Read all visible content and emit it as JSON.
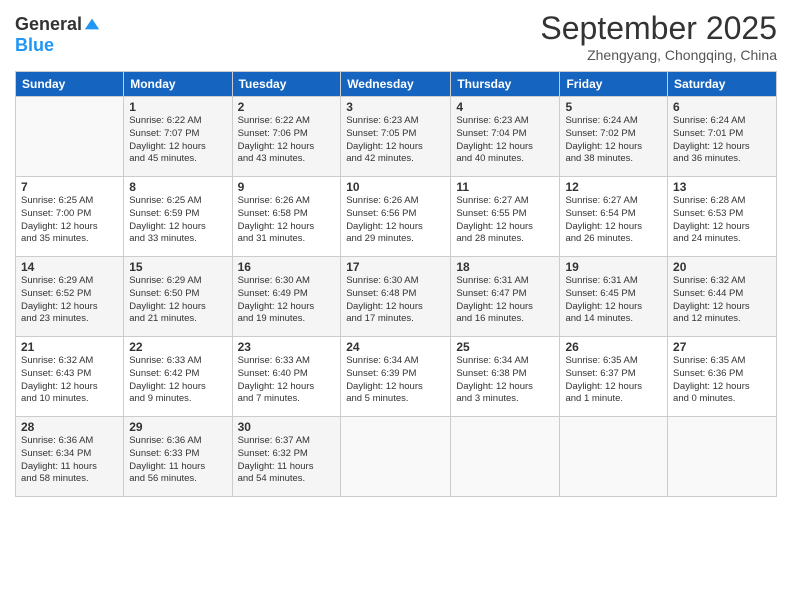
{
  "header": {
    "logo": {
      "general": "General",
      "blue": "Blue"
    },
    "title": "September 2025",
    "location": "Zhengyang, Chongqing, China"
  },
  "weekdays": [
    "Sunday",
    "Monday",
    "Tuesday",
    "Wednesday",
    "Thursday",
    "Friday",
    "Saturday"
  ],
  "weeks": [
    [
      {
        "day": "",
        "info": ""
      },
      {
        "day": "1",
        "info": "Sunrise: 6:22 AM\nSunset: 7:07 PM\nDaylight: 12 hours\nand 45 minutes."
      },
      {
        "day": "2",
        "info": "Sunrise: 6:22 AM\nSunset: 7:06 PM\nDaylight: 12 hours\nand 43 minutes."
      },
      {
        "day": "3",
        "info": "Sunrise: 6:23 AM\nSunset: 7:05 PM\nDaylight: 12 hours\nand 42 minutes."
      },
      {
        "day": "4",
        "info": "Sunrise: 6:23 AM\nSunset: 7:04 PM\nDaylight: 12 hours\nand 40 minutes."
      },
      {
        "day": "5",
        "info": "Sunrise: 6:24 AM\nSunset: 7:02 PM\nDaylight: 12 hours\nand 38 minutes."
      },
      {
        "day": "6",
        "info": "Sunrise: 6:24 AM\nSunset: 7:01 PM\nDaylight: 12 hours\nand 36 minutes."
      }
    ],
    [
      {
        "day": "7",
        "info": "Sunrise: 6:25 AM\nSunset: 7:00 PM\nDaylight: 12 hours\nand 35 minutes."
      },
      {
        "day": "8",
        "info": "Sunrise: 6:25 AM\nSunset: 6:59 PM\nDaylight: 12 hours\nand 33 minutes."
      },
      {
        "day": "9",
        "info": "Sunrise: 6:26 AM\nSunset: 6:58 PM\nDaylight: 12 hours\nand 31 minutes."
      },
      {
        "day": "10",
        "info": "Sunrise: 6:26 AM\nSunset: 6:56 PM\nDaylight: 12 hours\nand 29 minutes."
      },
      {
        "day": "11",
        "info": "Sunrise: 6:27 AM\nSunset: 6:55 PM\nDaylight: 12 hours\nand 28 minutes."
      },
      {
        "day": "12",
        "info": "Sunrise: 6:27 AM\nSunset: 6:54 PM\nDaylight: 12 hours\nand 26 minutes."
      },
      {
        "day": "13",
        "info": "Sunrise: 6:28 AM\nSunset: 6:53 PM\nDaylight: 12 hours\nand 24 minutes."
      }
    ],
    [
      {
        "day": "14",
        "info": "Sunrise: 6:29 AM\nSunset: 6:52 PM\nDaylight: 12 hours\nand 23 minutes."
      },
      {
        "day": "15",
        "info": "Sunrise: 6:29 AM\nSunset: 6:50 PM\nDaylight: 12 hours\nand 21 minutes."
      },
      {
        "day": "16",
        "info": "Sunrise: 6:30 AM\nSunset: 6:49 PM\nDaylight: 12 hours\nand 19 minutes."
      },
      {
        "day": "17",
        "info": "Sunrise: 6:30 AM\nSunset: 6:48 PM\nDaylight: 12 hours\nand 17 minutes."
      },
      {
        "day": "18",
        "info": "Sunrise: 6:31 AM\nSunset: 6:47 PM\nDaylight: 12 hours\nand 16 minutes."
      },
      {
        "day": "19",
        "info": "Sunrise: 6:31 AM\nSunset: 6:45 PM\nDaylight: 12 hours\nand 14 minutes."
      },
      {
        "day": "20",
        "info": "Sunrise: 6:32 AM\nSunset: 6:44 PM\nDaylight: 12 hours\nand 12 minutes."
      }
    ],
    [
      {
        "day": "21",
        "info": "Sunrise: 6:32 AM\nSunset: 6:43 PM\nDaylight: 12 hours\nand 10 minutes."
      },
      {
        "day": "22",
        "info": "Sunrise: 6:33 AM\nSunset: 6:42 PM\nDaylight: 12 hours\nand 9 minutes."
      },
      {
        "day": "23",
        "info": "Sunrise: 6:33 AM\nSunset: 6:40 PM\nDaylight: 12 hours\nand 7 minutes."
      },
      {
        "day": "24",
        "info": "Sunrise: 6:34 AM\nSunset: 6:39 PM\nDaylight: 12 hours\nand 5 minutes."
      },
      {
        "day": "25",
        "info": "Sunrise: 6:34 AM\nSunset: 6:38 PM\nDaylight: 12 hours\nand 3 minutes."
      },
      {
        "day": "26",
        "info": "Sunrise: 6:35 AM\nSunset: 6:37 PM\nDaylight: 12 hours\nand 1 minute."
      },
      {
        "day": "27",
        "info": "Sunrise: 6:35 AM\nSunset: 6:36 PM\nDaylight: 12 hours\nand 0 minutes."
      }
    ],
    [
      {
        "day": "28",
        "info": "Sunrise: 6:36 AM\nSunset: 6:34 PM\nDaylight: 11 hours\nand 58 minutes."
      },
      {
        "day": "29",
        "info": "Sunrise: 6:36 AM\nSunset: 6:33 PM\nDaylight: 11 hours\nand 56 minutes."
      },
      {
        "day": "30",
        "info": "Sunrise: 6:37 AM\nSunset: 6:32 PM\nDaylight: 11 hours\nand 54 minutes."
      },
      {
        "day": "",
        "info": ""
      },
      {
        "day": "",
        "info": ""
      },
      {
        "day": "",
        "info": ""
      },
      {
        "day": "",
        "info": ""
      }
    ]
  ]
}
